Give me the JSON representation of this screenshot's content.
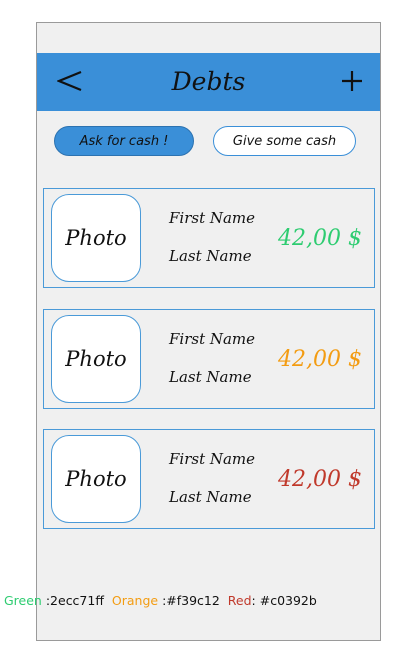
{
  "header": {
    "title": "Debts",
    "back_icon": "chevron-left-icon",
    "add_icon": "plus-icon",
    "color": "#3a8fd8"
  },
  "tabs": {
    "ask_label": "Ask for cash !",
    "give_label": "Give some cash"
  },
  "cards": [
    {
      "photo_label": "Photo",
      "first_name": "First Name",
      "last_name": "Last Name",
      "amount": "42,00 $",
      "color": "#2ecc71"
    },
    {
      "photo_label": "Photo",
      "first_name": "First Name",
      "last_name": "Last Name",
      "amount": "42,00 $",
      "color": "#f39c12"
    },
    {
      "photo_label": "Photo",
      "first_name": "First Name",
      "last_name": "Last Name",
      "amount": "42,00 $",
      "color": "#c0392b"
    }
  ],
  "legend": {
    "green_label": "Green",
    "green_value": " :2ecc71ff",
    "orange_label": "Orange",
    "orange_value": " :#f39c12",
    "red_label": "Red",
    "red_value": ": #c0392b",
    "green_color": "#2ecc71",
    "orange_color": "#f39c12",
    "red_color": "#c0392b"
  }
}
